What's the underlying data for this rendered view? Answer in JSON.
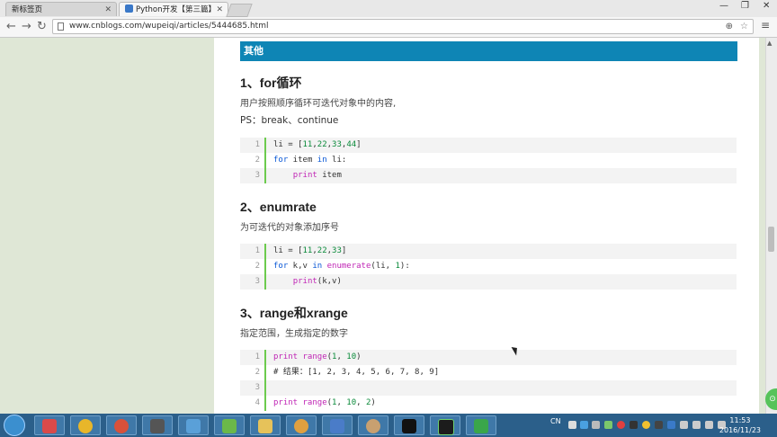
{
  "browser": {
    "tabs": [
      {
        "label": "新标签页",
        "active": false
      },
      {
        "label": "Python开发【第三篇】",
        "active": true
      }
    ],
    "url": "www.cnblogs.com/wupeiqi/articles/5444685.html"
  },
  "article": {
    "banner": "其他",
    "section1": {
      "heading": "1、for循环",
      "desc": "用户按照顺序循环可迭代对象中的内容,",
      "ps": "PS：break、continue",
      "code": [
        "li = [11,22,33,44]",
        "for item in li:",
        "    print item"
      ]
    },
    "section2": {
      "heading": "2、enumrate",
      "desc": "为可迭代的对象添加序号",
      "code": [
        "li = [11,22,33]",
        "for k,v in enumerate(li, 1):",
        "    print(k,v)"
      ]
    },
    "section3": {
      "heading": "3、range和xrange",
      "desc": "指定范围，生成指定的数字",
      "code": [
        "print range(1, 10)",
        "# 结果：[1, 2, 3, 4, 5, 6, 7, 8, 9]",
        "",
        "print range(1, 10, 2)"
      ]
    }
  },
  "taskbar": {
    "tray_text": "CN",
    "time": "11:53",
    "date": "2016/11/23"
  }
}
